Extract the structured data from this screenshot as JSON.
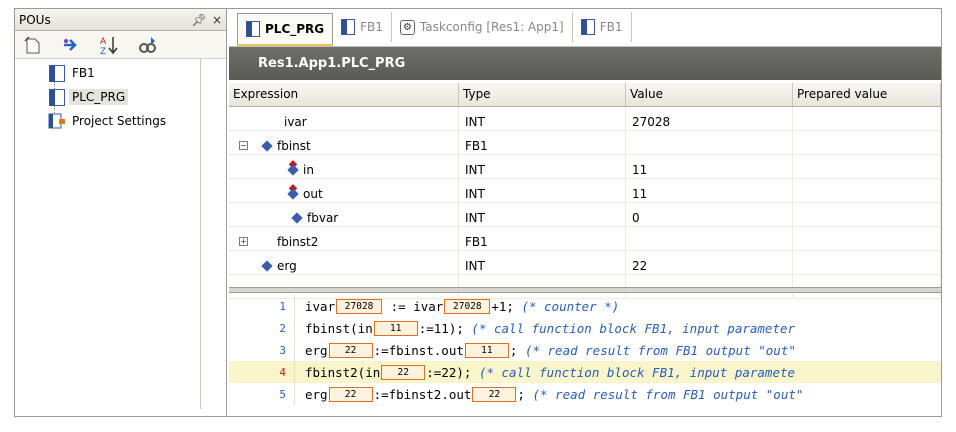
{
  "left_panel": {
    "title": "POUs",
    "pin": "ᵖ",
    "close": "×",
    "tree": [
      {
        "label": "FB1",
        "icon": "function-block-icon",
        "selected": false
      },
      {
        "label": "PLC_PRG",
        "icon": "program-icon",
        "selected": true
      },
      {
        "label": "Project Settings",
        "icon": "project-settings-icon",
        "selected": false
      }
    ]
  },
  "tabs": [
    {
      "label": "PLC_PRG",
      "active": true,
      "icon": "pou-icon"
    },
    {
      "label": "FB1",
      "active": false,
      "icon": "pou-icon"
    },
    {
      "label": "Taskconfig [Res1: App1]",
      "active": false,
      "icon": "taskconfig-icon"
    },
    {
      "label": "FB1",
      "active": false,
      "icon": "pou-icon"
    }
  ],
  "panel_title": "Res1.App1.PLC_PRG",
  "watch": {
    "columns": [
      "Expression",
      "Type",
      "Value",
      "Prepared value"
    ],
    "rows": [
      {
        "expr": "ivar",
        "type": "INT",
        "value": "27028",
        "prepared": ""
      },
      {
        "expr": "fbinst",
        "type": "FB1",
        "value": "",
        "prepared": ""
      },
      {
        "expr": "in",
        "type": "INT",
        "value": "11",
        "prepared": ""
      },
      {
        "expr": "out",
        "type": "INT",
        "value": "11",
        "prepared": ""
      },
      {
        "expr": "fbvar",
        "type": "INT",
        "value": "0",
        "prepared": ""
      },
      {
        "expr": "fbinst2",
        "type": "FB1",
        "value": "",
        "prepared": ""
      },
      {
        "expr": "erg",
        "type": "INT",
        "value": "22",
        "prepared": ""
      }
    ]
  },
  "code": {
    "lines": [
      {
        "num": "1",
        "a": "ivar",
        "b1": "27028",
        "c": " := ivar",
        "b2": "27028",
        "d": "+1; ",
        "cmt": "(* counter *)"
      },
      {
        "num": "2",
        "a": "fbinst(in",
        "b1": "11",
        "c": ":=11); ",
        "cmt": "(* call function block FB1, input parameter"
      },
      {
        "num": "3",
        "a": "erg",
        "b1": "22",
        "c": ":=fbinst.out",
        "b2": "11",
        "d": "; ",
        "cmt": "(* read result from FB1 output \"out\""
      },
      {
        "num": "4",
        "a": "fbinst2(in",
        "b1": "22",
        "c": ":=22); ",
        "cmt": "(* call function block FB1, input paramete"
      },
      {
        "num": "5",
        "a": "erg",
        "b1": "22",
        "c": ":=fbinst2.out",
        "b2": "22",
        "d": "; ",
        "cmt": "(* read result from FB1 output \"out\""
      }
    ]
  }
}
